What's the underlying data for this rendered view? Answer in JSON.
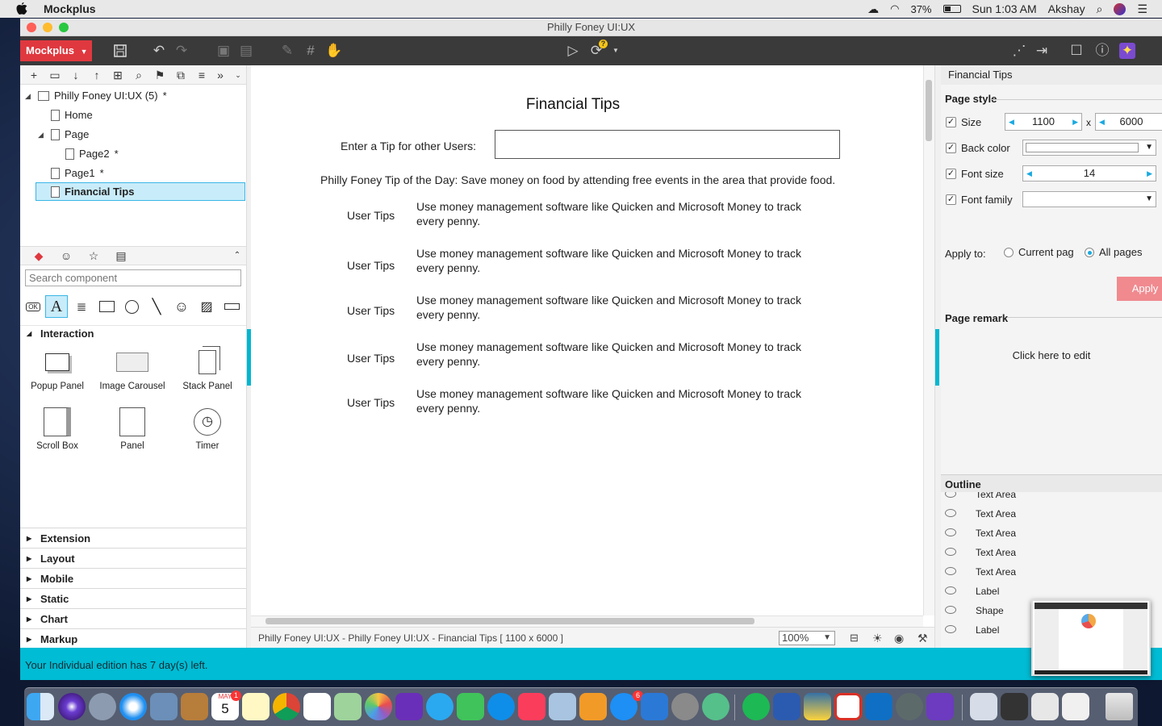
{
  "menubar": {
    "app_name": "Mockplus",
    "battery": "37%",
    "clock": "Sun 1:03 AM",
    "user": "Akshay"
  },
  "window": {
    "title": "Philly Foney UI:UX"
  },
  "toolbar": {
    "brand_label": "Mockplus",
    "icons": [
      "save-icon",
      "undo-icon",
      "redo-icon",
      "group-icon",
      "ungroup-icon",
      "format-brush-icon",
      "grid-icon",
      "hand-icon",
      "play-icon",
      "sync-icon",
      "share-icon",
      "export-icon",
      "fullscreen-icon",
      "help-icon",
      "theme-icon"
    ]
  },
  "tree": {
    "project": "Philly Foney UI:UX (5)",
    "project_mark": "*",
    "items": [
      {
        "label": "Home",
        "mark": ""
      },
      {
        "label": "Page",
        "mark": ""
      },
      {
        "label": "Page2",
        "mark": "*"
      },
      {
        "label": "Page1",
        "mark": "*"
      },
      {
        "label": "Financial Tips",
        "mark": ""
      }
    ]
  },
  "components": {
    "search_placeholder": "Search component",
    "section_open": "Interaction",
    "items": [
      "Popup Panel",
      "Image Carousel",
      "Stack Panel",
      "Scroll Box",
      "Panel",
      "Timer"
    ],
    "categories": [
      "Extension",
      "Layout",
      "Mobile",
      "Static",
      "Chart",
      "Markup"
    ]
  },
  "canvas": {
    "title": "Financial Tips",
    "tip_label": "Enter a Tip for other Users:",
    "tip_of_day": "Philly Foney Tip of the Day:  Save money on food by attending free events in the area that provide food.",
    "user_tips": [
      {
        "label": "User Tips",
        "line1": "Use money management software like Quicken and Microsoft Money to track",
        "line2": "every penny."
      },
      {
        "label": "User Tips",
        "line1": "Use money management software like Quicken and Microsoft Money to track",
        "line2": "every penny."
      },
      {
        "label": "User Tips",
        "line1": "Use money management software like Quicken and Microsoft Money to track",
        "line2": "every penny."
      },
      {
        "label": "User Tips",
        "line1": "Use money management software like Quicken and Microsoft Money to track",
        "line2": "every penny."
      },
      {
        "label": "User Tips",
        "line1": "Use money management software like Quicken and Microsoft Money to track",
        "line2": "every penny."
      }
    ]
  },
  "status": {
    "path": "Philly Foney UI:UX - Philly Foney UI:UX - Financial Tips [ 1100 x 6000 ]",
    "zoom": "100%"
  },
  "properties": {
    "page_name": "Financial Tips",
    "section_page_style": "Page style",
    "size_label": "Size",
    "width": "1100",
    "times": "x",
    "height": "6000",
    "back_color_label": "Back color",
    "font_size_label": "Font size",
    "font_size": "14",
    "font_family_label": "Font family",
    "apply_to_label": "Apply to:",
    "current_page": "Current pag",
    "all_pages": "All pages",
    "apply": "Apply",
    "section_remark": "Page remark",
    "remark_edit": "Click here to edit"
  },
  "outline": {
    "title": "Outline",
    "items": [
      "Text Area",
      "Text Area",
      "Text Area",
      "Text Area",
      "Text Area",
      "Label",
      "Shape",
      "Label"
    ]
  },
  "notice": "Your Individual edition has 7 day(s) left.",
  "dock": {
    "calendar_month": "MAY",
    "calendar_day": "5",
    "calendar_badge": "1",
    "appstore_badge": "6"
  },
  "colors": {
    "brand": "#e0383f",
    "accent": "#00bcd4",
    "selection": "#c9ecfa",
    "apply": "#f08a8f"
  }
}
